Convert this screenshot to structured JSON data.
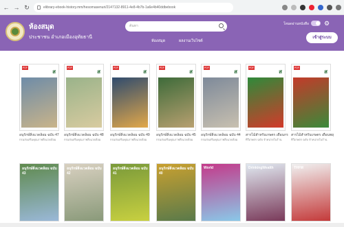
{
  "browser": {
    "url": "elibrary-ebook-history.mm/hesomasenuri/2147132-8911-4e8-4b7b-1a6e4b40ddbebook"
  },
  "header": {
    "title": "ห้องสมุด",
    "subtitle": "ประชาชน อำเภอเมืองอุทัยธานี",
    "search_placeholder": "ค้นหา",
    "nav": [
      "ห้องสมุด",
      "ผลงานเว็บไซต์"
    ],
    "toggle_label": "โหมดอ่านหนังสือ",
    "login_label": "เข้าสู่ระบบ"
  },
  "books_row1": [
    {
      "title": "อนุรักษ์สิ่งแวดล้อม ฉบับ 47",
      "sub": "กรมส่งเสริมคุณภาพสิ่งแวดล้อม",
      "pic": "#6e8ca8",
      "pic2": "#c9b48a"
    },
    {
      "title": "อนุรักษ์สิ่งแวดล้อม ฉบับ 48",
      "sub": "กรมส่งเสริมคุณภาพสิ่งแวดล้อม",
      "pic": "#9ab38a",
      "pic2": "#d8cba0"
    },
    {
      "title": "อนุรักษ์สิ่งแวดล้อม ฉบับ 49",
      "sub": "กรมส่งเสริมคุณภาพสิ่งแวดล้อม",
      "pic": "#2f4b6e",
      "pic2": "#e2a84a"
    },
    {
      "title": "อนุรักษ์สิ่งแวดล้อม ฉบับ 45",
      "sub": "กรมส่งเสริมคุณภาพสิ่งแวดล้อม",
      "pic": "#3e6b3a",
      "pic2": "#b8a070"
    },
    {
      "title": "อนุรักษ์สิ่งแวดล้อม ฉบับ 44",
      "sub": "กรมส่งเสริมคุณภาพสิ่งแวดล้อม",
      "pic": "#7e8a9a",
      "pic2": "#c8c0b0"
    },
    {
      "title": "สารไม้สำหรับเกษตร เดือนกรกฎาคม 2565",
      "sub": "ทีวีเกษตร ฉบับ จำหน่ายในร้าน",
      "pic": "#2e8a3a",
      "pic2": "#d33a2a"
    },
    {
      "title": "สารไม้สำหรับเกษตร เดือนพฤษภาคม 2565",
      "sub": "ทีวีเกษตร ฉบับ จำหน่ายในร้าน",
      "pic": "#c43a2a",
      "pic2": "#3a8a3a"
    }
  ],
  "books_row2": [
    {
      "title": "อนุรักษ์สิ่งแวดล้อม ฉบับ 43",
      "pic": "#5f8a4e",
      "pic2": "#9ab8d8"
    },
    {
      "title": "อนุรักษ์สิ่งแวดล้อม ฉบับ 42",
      "pic": "#d8d0c0",
      "pic2": "#8a9a7a"
    },
    {
      "title": "อนุรักษ์สิ่งแวดล้อม ฉบับ 41",
      "pic": "#7a9a3a",
      "pic2": "#c8d040"
    },
    {
      "title": "อนุรักษ์สิ่งแวดล้อม ฉบับ 40",
      "pic": "#c8a030",
      "pic2": "#5a7a4a"
    },
    {
      "title": "World",
      "pic": "#c43a8a",
      "pic2": "#8ac8e8"
    },
    {
      "title": "DrinkingWealth",
      "pic": "#e0e8f0",
      "pic2": "#7a3a5a"
    },
    {
      "title": "THFM",
      "pic": "#f0f0f0",
      "pic2": "#c43a3a"
    }
  ]
}
